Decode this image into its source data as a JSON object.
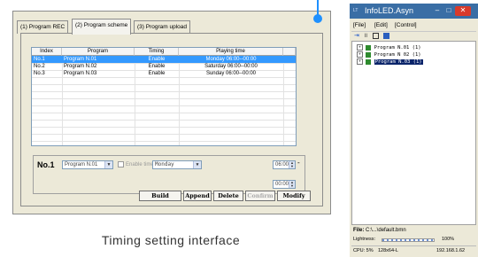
{
  "dialog": {
    "tabs": [
      "(1) Program REC",
      "(2) Program scheme",
      "(3) Program upload"
    ],
    "table": {
      "columns": [
        "Index",
        "Program",
        "Timing",
        "Playing time"
      ],
      "rows": [
        {
          "index": "No.1",
          "program": "Program N.01",
          "timing": "Enable",
          "time": "Monday 06:00--00:00",
          "selected": true
        },
        {
          "index": "No.2",
          "program": "Program N.02",
          "timing": "Enable",
          "time": "Saturday 06:00--00:00",
          "selected": false
        },
        {
          "index": "No.3",
          "program": "Program N.03",
          "timing": "Enable",
          "time": "Sunday 06:00--00:00",
          "selected": false
        }
      ]
    },
    "form": {
      "index_label": "No.1",
      "program_value": "Program N.01",
      "enable_time_label": "Enable time",
      "day_value": "Monday",
      "start_time": "06:00",
      "end_time": "00:00",
      "dash": "-"
    },
    "buttons": {
      "build": "Build",
      "append": "Append",
      "delete": "Delete",
      "confirm": "Confirm",
      "modify": "Modify"
    }
  },
  "caption": "Timing setting interface",
  "app_window": {
    "title": "InfoLED.Asyn",
    "title_prefix": "LT",
    "title_buttons": {
      "minimize": "–",
      "maximize": "□",
      "close": "✕"
    },
    "menu": [
      "[File]",
      "[Edit]",
      "[Control]"
    ],
    "tree_items": [
      {
        "label": "Program N.01 (1)",
        "selected": false
      },
      {
        "label": "Program N 02 (1)",
        "selected": false
      },
      {
        "label": "Program N.03 (1)",
        "selected": true
      }
    ],
    "file_label": "File:",
    "file_value": "C:\\...\\default.bmn",
    "lightness_label": "Lightness:",
    "lightness_value": "100%",
    "cpu": "CPU: 5%",
    "resolution": "128x64-L",
    "ip": "192.168.1.62"
  },
  "colors": {
    "accent": "#1e90ff",
    "selected_row": "#3399ff",
    "tree_selected": "#0a246a"
  }
}
